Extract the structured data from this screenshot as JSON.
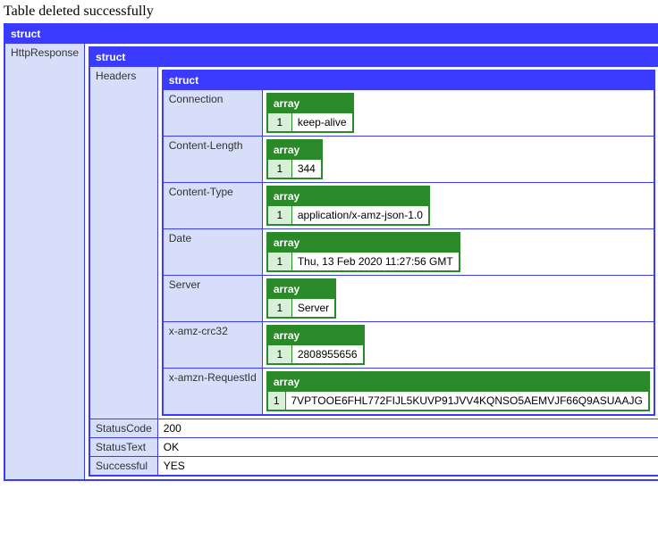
{
  "title": "Table deleted successfully",
  "labels": {
    "struct": "struct",
    "array": "array"
  },
  "root": {
    "httpResponseKey": "HttpResponse",
    "httpResponse": {
      "headersKey": "Headers",
      "headers": {
        "connection": {
          "key": "Connection",
          "index": "1",
          "value": "keep-alive"
        },
        "contentLength": {
          "key": "Content-Length",
          "index": "1",
          "value": "344"
        },
        "contentType": {
          "key": "Content-Type",
          "index": "1",
          "value": "application/x-amz-json-1.0"
        },
        "date": {
          "key": "Date",
          "index": "1",
          "value": "Thu, 13 Feb 2020 11:27:56 GMT"
        },
        "server": {
          "key": "Server",
          "index": "1",
          "value": "Server"
        },
        "crc32": {
          "key": "x-amz-crc32",
          "index": "1",
          "value": "2808955656"
        },
        "requestId": {
          "key": "x-amzn-RequestId",
          "index": "1",
          "value": "7VPTOOE6FHL772FIJL5KUVP91JVV4KQNSO5AEMVJF66Q9ASUAAJG"
        }
      },
      "statusCode": {
        "key": "StatusCode",
        "value": "200"
      },
      "statusText": {
        "key": "StatusText",
        "value": "OK"
      },
      "successful": {
        "key": "Successful",
        "value": "YES"
      }
    }
  }
}
